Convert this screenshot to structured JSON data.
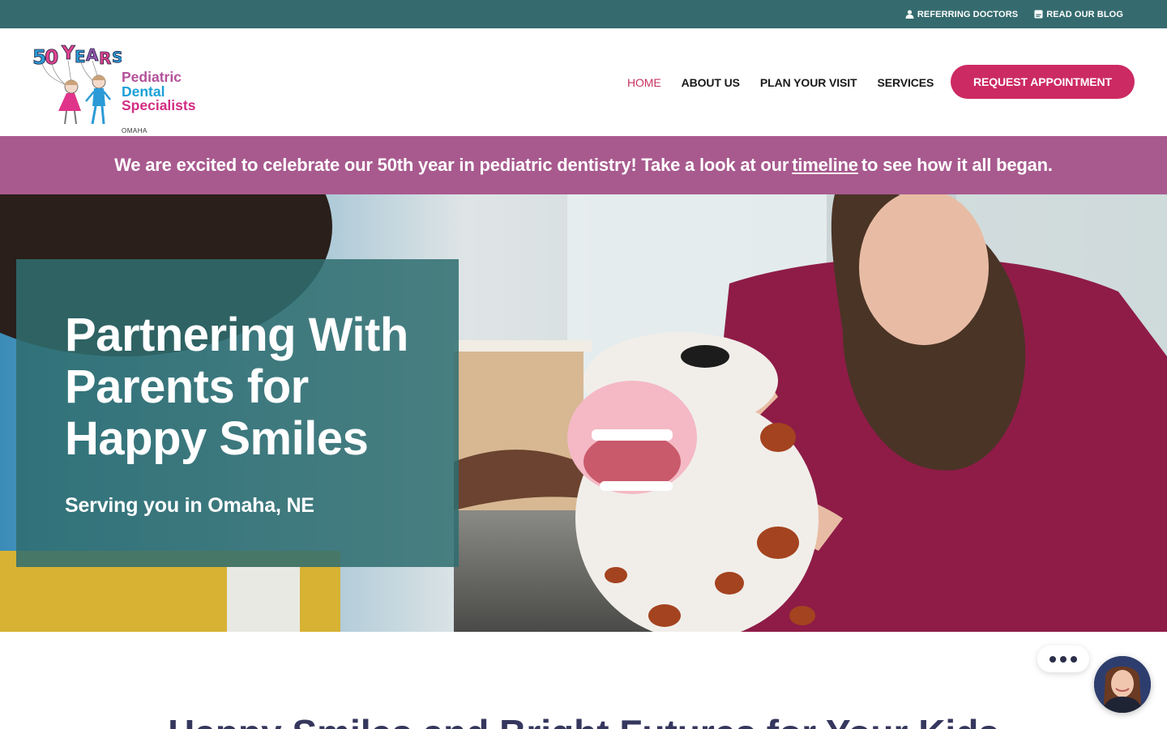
{
  "utility_bar": {
    "links": [
      {
        "label": "REFERRING DOCTORS",
        "icon": "user-icon"
      },
      {
        "label": "READ OUR BLOG",
        "icon": "blog-icon"
      }
    ]
  },
  "header": {
    "logo": {
      "badge": "50 YEARS",
      "lines": [
        "Pediatric",
        "Dental",
        "Specialists"
      ],
      "city": "OMAHA"
    },
    "nav": [
      {
        "label": "HOME",
        "active": true
      },
      {
        "label": "ABOUT US",
        "active": false
      },
      {
        "label": "PLAN YOUR VISIT",
        "active": false
      },
      {
        "label": "SERVICES",
        "active": false
      }
    ],
    "cta_label": "REQUEST APPOINTMENT"
  },
  "announcement": {
    "before": "We are excited to celebrate our 50th year in pediatric dentistry! Take a look at our",
    "link": "timeline",
    "after": "to see how it all began."
  },
  "hero": {
    "title": "Partnering With Parents for Happy Smiles",
    "subtitle": "Serving you in Omaha, NE",
    "image": "dentist-with-plush-dog-teeth-model"
  },
  "section": {
    "heading": "Happy Smiles and Bright Futures for Your Kids"
  },
  "chat": {
    "icon": "more-dots-icon",
    "avatar": "agent-avatar"
  },
  "colors": {
    "utility_bar": "#356b6e",
    "accent": "#cc2a62",
    "banner": "#a85a8e",
    "hero_card": "#2f6e70",
    "heading": "#35375e"
  }
}
